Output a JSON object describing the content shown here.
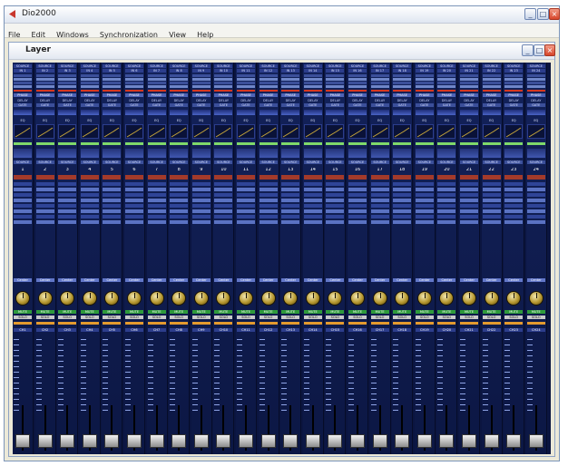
{
  "window": {
    "title": "Dio2000",
    "minimize_symbol": "_",
    "maximize_symbol": "□",
    "close_symbol": "×",
    "icon": "app-logo-icon",
    "accent": "#c8372d"
  },
  "menu": [
    "File",
    "Edit",
    "Windows",
    "Synchronization",
    "View",
    "Help"
  ],
  "layer_window": {
    "title": "Layer"
  },
  "channels": [
    {
      "label": "1",
      "out": "CH1"
    },
    {
      "label": "2",
      "out": "CH2"
    },
    {
      "label": "3",
      "out": "CH3"
    },
    {
      "label": "4",
      "out": "CH4"
    },
    {
      "label": "5",
      "out": "CH5"
    },
    {
      "label": "6",
      "out": "CH6"
    },
    {
      "label": "7",
      "out": "CH7"
    },
    {
      "label": "8",
      "out": "CH8"
    },
    {
      "label": "9",
      "out": "CH9"
    },
    {
      "label": "10",
      "out": "CH10"
    },
    {
      "label": "11",
      "out": "CH11"
    },
    {
      "label": "12",
      "out": "CH12"
    },
    {
      "label": "13",
      "out": "CH13"
    },
    {
      "label": "14",
      "out": "CH14"
    },
    {
      "label": "15",
      "out": "CH15"
    },
    {
      "label": "16",
      "out": "CH16"
    },
    {
      "label": "17",
      "out": "CH17"
    },
    {
      "label": "18",
      "out": "CH18"
    },
    {
      "label": "19",
      "out": "CH19"
    },
    {
      "label": "20",
      "out": "CH20"
    },
    {
      "label": "21",
      "out": "CH21"
    },
    {
      "label": "22",
      "out": "CH22"
    },
    {
      "label": "23",
      "out": "CH23"
    },
    {
      "label": "24",
      "out": "CH24"
    }
  ],
  "strip_text": {
    "source": "SOURCE",
    "input": "IN",
    "phase": "PHASE",
    "delay": "DELAY",
    "gate": "GATE",
    "eq": "EQ",
    "pan": "Center",
    "mute": "MUTE",
    "solo": "SOLO"
  }
}
